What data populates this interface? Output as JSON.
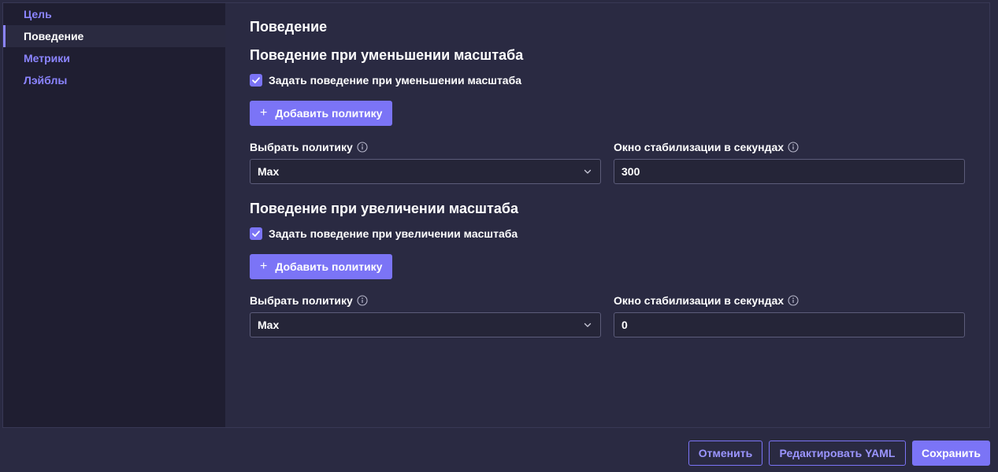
{
  "sidebar": {
    "items": [
      {
        "label": "Цель"
      },
      {
        "label": "Поведение"
      },
      {
        "label": "Метрики"
      },
      {
        "label": "Лэйблы"
      }
    ]
  },
  "main": {
    "title": "Поведение",
    "scale_down": {
      "title": "Поведение при уменьшении масштаба",
      "checkbox_label": "Задать поведение при уменьшении масштаба",
      "checked": true,
      "add_policy_label": "Добавить политику",
      "policy_label": "Выбрать политику",
      "policy_value": "Max",
      "window_label": "Окно стабилизации в секундах",
      "window_value": "300"
    },
    "scale_up": {
      "title": "Поведение при увеличении масштаба",
      "checkbox_label": "Задать поведение при увеличении масштаба",
      "checked": true,
      "add_policy_label": "Добавить политику",
      "policy_label": "Выбрать политику",
      "policy_value": "Max",
      "window_label": "Окно стабилизации в секундах",
      "window_value": "0"
    }
  },
  "footer": {
    "cancel_label": "Отменить",
    "edit_yaml_label": "Редактировать YAML",
    "save_label": "Сохранить"
  },
  "colors": {
    "accent": "#7b74f6",
    "accent_text": "#8b84ff",
    "background": "#2a2a42",
    "sidebar_bg": "#1f1e31"
  },
  "icons": {
    "checkbox": "check-icon",
    "add": "plus-icon",
    "info": "info-icon",
    "select": "chevron-down-icon"
  }
}
